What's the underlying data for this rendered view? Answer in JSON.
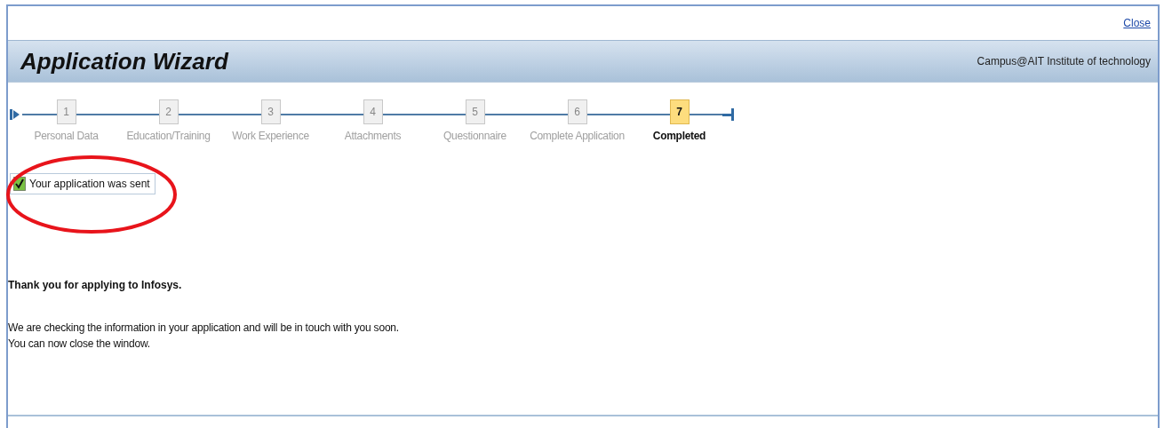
{
  "close_link": "Close",
  "header": {
    "title": "Application Wizard",
    "organization": "Campus@AIT Institute of technology"
  },
  "steps": [
    {
      "number": "1",
      "label": "Personal Data",
      "selected": false
    },
    {
      "number": "2",
      "label": "Education/Training",
      "selected": false
    },
    {
      "number": "3",
      "label": "Work Experience",
      "selected": false
    },
    {
      "number": "4",
      "label": "Attachments",
      "selected": false
    },
    {
      "number": "5",
      "label": "Questionnaire",
      "selected": false
    },
    {
      "number": "6",
      "label": "Complete Application",
      "selected": false
    },
    {
      "number": "7",
      "label": "Completed",
      "selected": true
    }
  ],
  "message": {
    "text": "Your application was sent",
    "checked": true
  },
  "thank_you": "Thank you for applying to Infosys.",
  "body_lines": [
    "We are checking the information in your application and will be in touch with you soon.",
    "You can now close the window."
  ]
}
